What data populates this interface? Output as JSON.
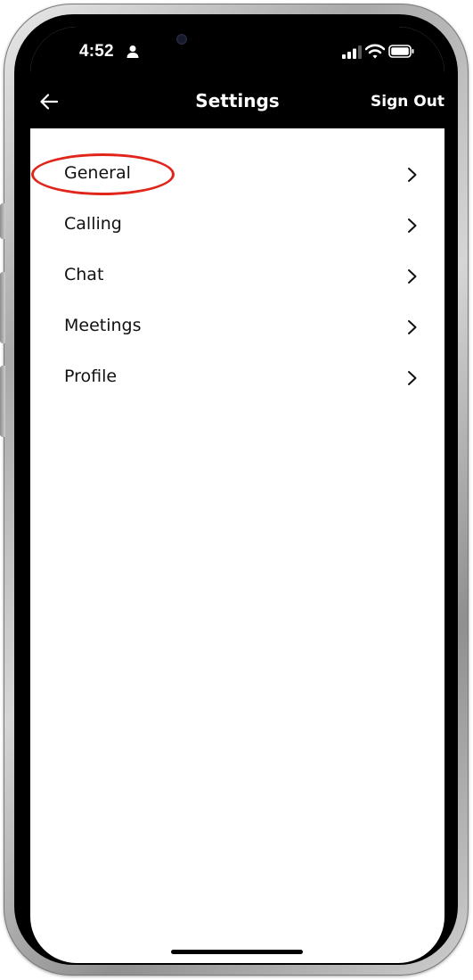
{
  "status_bar": {
    "time": "4:52",
    "icons": [
      "person-icon",
      "cellular-signal-icon",
      "wifi-icon",
      "battery-icon"
    ]
  },
  "header": {
    "back_icon": "arrow-left-icon",
    "title": "Settings",
    "sign_out_label": "Sign Out"
  },
  "menu": {
    "items": [
      {
        "label": "General",
        "icon": "chevron-right-icon",
        "highlighted": true
      },
      {
        "label": "Calling",
        "icon": "chevron-right-icon",
        "highlighted": false
      },
      {
        "label": "Chat",
        "icon": "chevron-right-icon",
        "highlighted": false
      },
      {
        "label": "Meetings",
        "icon": "chevron-right-icon",
        "highlighted": false
      },
      {
        "label": "Profile",
        "icon": "chevron-right-icon",
        "highlighted": false
      }
    ]
  },
  "colors": {
    "header_background": "#000000",
    "screen_background": "#ffffff",
    "annotation_red": "#e0251b",
    "text": "#111111"
  }
}
